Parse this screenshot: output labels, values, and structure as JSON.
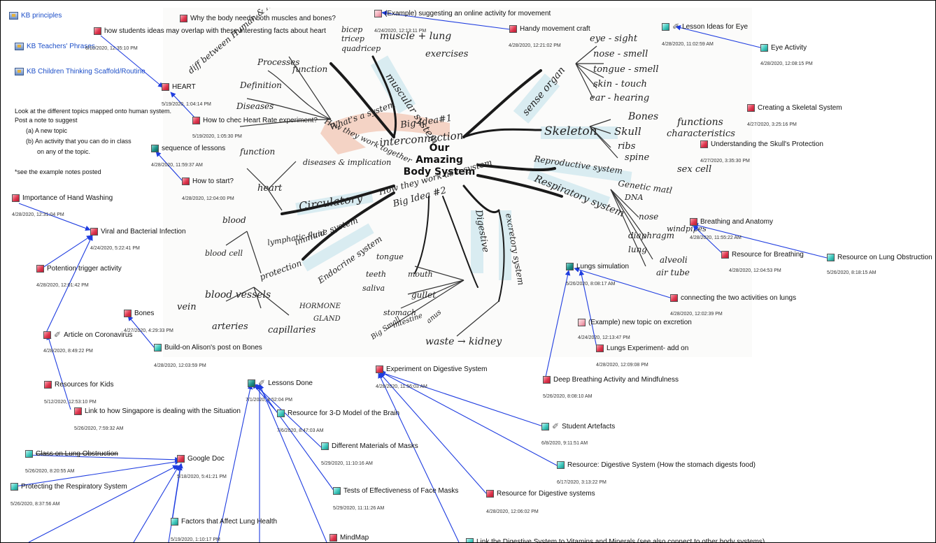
{
  "kb_links": [
    "KB principles",
    "KB Teachers' Phrases",
    "KB Children Thinking Scaffold/Routine"
  ],
  "kb_timestamp": "6/10/2020, 12:35:10 PM",
  "instructions": {
    "line1": "Look at the different topics mapped onto human system.",
    "line2": "Post a note to suggest",
    "line3": "(a)  A new topic",
    "line4": "(b)  An activity that you can do in class",
    "line5": "on any of the topic.",
    "line6": "*see the example notes posted"
  },
  "mindmap": {
    "center_lines": [
      "Our",
      "Amazing",
      "Body System"
    ],
    "labels": {
      "muscular": "muscular system",
      "skeleton": "Skeleton",
      "sense_organ": "sense organ",
      "circulatory": "Circulatory",
      "immune": "immune system",
      "endocrine": "Endocrine system",
      "digestive": "Digestive",
      "excretory": "excretory system",
      "reproductive": "Reproductive system",
      "respiratory": "Respiratory system",
      "big_idea1": "Big Idea#1",
      "interconnection": "interconnection",
      "big_idea2": "Big Idea #2",
      "how_work": "How they work as a system",
      "whats_system": "What's a system",
      "how_together": "How they work together",
      "diff_between": "diff between Human & Animals",
      "processes": "Processes",
      "function": "function",
      "definition": "Definition",
      "diseases": "Diseases",
      "bicep": "bicep",
      "tricep": "tricep",
      "quadricep": "quadricep",
      "muscle_lung": "muscle + lung",
      "exercises": "exercises",
      "eye": "eye - sight",
      "nose": "nose - smell",
      "tongue": "tongue - smell",
      "skin": "skin - touch",
      "ear": "ear - hearing",
      "bones": "Bones",
      "skull": "Skull",
      "ribs": "ribs",
      "spine": "spine",
      "functions": "functions",
      "characteristics": "characteristics",
      "sex_cell": "sex cell",
      "genetic": "Genetic matl",
      "dna": "DNA",
      "nose2": "nose",
      "windpipe": "windpipes",
      "diaphragm": "diaphragm",
      "lung": "lung",
      "alveoli": "alveoli",
      "air_tube": "air tube",
      "heart": "heart",
      "function2": "function",
      "diseases_impl": "diseases & implication",
      "blood": "blood",
      "blood_cell": "blood cell",
      "blood_vessels": "blood vessels",
      "vein": "vein",
      "arteries": "arteries",
      "capillaries": "capillaries",
      "lymphatic": "lymphatic fluid",
      "protection": "protection",
      "hormone": "HORMONE",
      "gland": "GLAND",
      "tongue2": "tongue",
      "teeth": "teeth",
      "saliva": "saliva",
      "mouth": "mouth",
      "gullet": "gullet",
      "stomach": "stomach",
      "intestine": "intestine",
      "anus": "anus",
      "big_small": "Big Small",
      "waste_kidney": "waste → kidney"
    }
  },
  "nodes": [
    {
      "id": "why-body",
      "label": "Why the body needs both muscles and bones?",
      "ts": "",
      "icon": "red"
    },
    {
      "id": "how-ideas",
      "label": "how students ideas may overlap with these interesting facts about heart",
      "ts": "",
      "icon": "red"
    },
    {
      "id": "example-online",
      "label": "(Example) suggesting an online activity for movement",
      "ts": "4/24/2020, 12:13:11 PM",
      "icon": "doc"
    },
    {
      "id": "handy-movement",
      "label": "Handy movement craft",
      "ts": "4/28/2020, 12:21:02 PM",
      "icon": "red"
    },
    {
      "id": "lesson-eye",
      "label": "Lesson Ideas for Eye",
      "ts": "4/28/2020, 11:02:59 AM",
      "icon": "teal",
      "clip": true
    },
    {
      "id": "eye-activity",
      "label": "Eye Activity",
      "ts": "4/28/2020, 12:08:15 PM",
      "icon": "teal"
    },
    {
      "id": "heart",
      "label": "HEART",
      "ts": "5/19/2020, 1:04:14 PM",
      "icon": "red"
    },
    {
      "id": "heart-rate",
      "label": "How to chec Heart Rate experiment?",
      "ts": "5/19/2020, 1:05:30 PM",
      "icon": "red"
    },
    {
      "id": "sequence",
      "label": "sequence of lessons",
      "ts": "4/28/2020, 11:59:37 AM",
      "icon": "dteal"
    },
    {
      "id": "how-start",
      "label": "How to start?",
      "ts": "4/28/2020, 12:04:00 PM",
      "icon": "red"
    },
    {
      "id": "skeletal-system",
      "label": "Creating a Skeletal System",
      "ts": "4/27/2020, 3:25:16 PM",
      "icon": "red"
    },
    {
      "id": "skull-protection",
      "label": "Understanding the Skull's Protection",
      "ts": "4/27/2020, 3:35:30 PM",
      "icon": "red"
    },
    {
      "id": "hand-washing",
      "label": "Importance of Hand Washing",
      "ts": "4/28/2020, 12:31:04 PM",
      "icon": "red"
    },
    {
      "id": "viral",
      "label": "Viral and Bacterial Infection",
      "ts": "4/24/2020, 5:22:41 PM",
      "icon": "red"
    },
    {
      "id": "potention",
      "label": "Potention trigger activity",
      "ts": "4/28/2020, 12:01:42 PM",
      "icon": "red"
    },
    {
      "id": "breathing-anatomy",
      "label": "Breathing and Anatomy",
      "ts": "4/28/2020, 11:55:22 AM",
      "icon": "red"
    },
    {
      "id": "resource-breathing",
      "label": "Resource for Breathing",
      "ts": "4/28/2020, 12:04:53 PM",
      "icon": "red"
    },
    {
      "id": "lung-obstruction",
      "label": "Resource on Lung Obstruction",
      "ts": "5/26/2020, 8:18:15 AM",
      "icon": "teal"
    },
    {
      "id": "lungs-sim",
      "label": "Lungs simulation",
      "ts": "5/26/2020, 8:08:17 AM",
      "icon": "dteal"
    },
    {
      "id": "connecting-lungs",
      "label": "connecting the two activities on lungs",
      "ts": "4/28/2020, 12:02:39 PM",
      "icon": "red"
    },
    {
      "id": "example-excretion",
      "label": "(Example) new topic on excretion",
      "ts": "4/24/2020, 12:13:47 PM",
      "icon": "doc"
    },
    {
      "id": "lungs-experiment",
      "label": "Lungs Experiment- add on",
      "ts": "4/28/2020, 12:09:08 PM",
      "icon": "red"
    },
    {
      "id": "bones",
      "label": "Bones",
      "ts": "4/27/2020, 4:29:33 PM",
      "icon": "red"
    },
    {
      "id": "coronavirus",
      "label": "Article on Coronavirus",
      "ts": "4/28/2020, 8:49:22 PM",
      "icon": "red",
      "clip": true
    },
    {
      "id": "build-alison",
      "label": "Build-on Alison's post on Bones",
      "ts": "4/28/2020, 12:03:59 PM",
      "icon": "teal"
    },
    {
      "id": "deep-breathing",
      "label": "Deep Breathing Activity and Mindfulness",
      "ts": "5/26/2020, 8:08:10 AM",
      "icon": "red"
    },
    {
      "id": "digestive-exp",
      "label": "Experiment on Digestive System",
      "ts": "4/28/2020, 11:56:03 AM",
      "icon": "red"
    },
    {
      "id": "resources-kids",
      "label": "Resources for Kids",
      "ts": "5/12/2020, 12:53:10 PM",
      "icon": "red"
    },
    {
      "id": "lessons-done",
      "label": "Lessons Done",
      "ts": "7/1/2020, 4:52:04 PM",
      "icon": "dteal",
      "clip": true
    },
    {
      "id": "singapore",
      "label": "Link to how Singapore is dealing with the Situation",
      "ts": "5/26/2020, 7:59:32 AM",
      "icon": "red"
    },
    {
      "id": "brain-model",
      "label": "Resource for 3-D Model of the Brain",
      "ts": "7/6/2020, 8:47:03 AM",
      "icon": "teal"
    },
    {
      "id": "student-artefacts",
      "label": "Student Artefacts",
      "ts": "6/8/2020, 9:11:51 AM",
      "icon": "teal",
      "clip": true
    },
    {
      "id": "masks",
      "label": "Different Materials of Masks",
      "ts": "5/29/2020, 11:10:16 AM",
      "icon": "teal"
    },
    {
      "id": "class-lung",
      "label": "Class on Lung Obstruction",
      "ts": "5/26/2020, 8:20:55 AM",
      "icon": "teal",
      "strike": true
    },
    {
      "id": "google-doc",
      "label": "Google Doc",
      "ts": "5/18/2020, 5:41:21 PM",
      "icon": "red"
    },
    {
      "id": "stomach-digests",
      "label": "Resource: Digestive System (How the stomach digests food)",
      "ts": "6/17/2020, 3:13:22 PM",
      "icon": "teal"
    },
    {
      "id": "protecting-resp",
      "label": "Protecting the Respiratory System",
      "ts": "5/26/2020, 8:37:56 AM",
      "icon": "teal"
    },
    {
      "id": "face-masks",
      "label": "Tests of Effectiveness of Face Masks",
      "ts": "5/29/2020, 11:11:26 AM",
      "icon": "teal"
    },
    {
      "id": "digestive-resources",
      "label": "Resource for Digestive systems",
      "ts": "4/28/2020, 12:06:02 PM",
      "icon": "red"
    },
    {
      "id": "lung-health",
      "label": "Factors that Affect Lung Health",
      "ts": "5/19/2020, 1:10:17 PM",
      "icon": "teal"
    },
    {
      "id": "mindmap",
      "label": "MindMap",
      "ts": "",
      "icon": "red"
    },
    {
      "id": "vitamins",
      "label": "Link the Digestive System to Vitamins and Minerals (see also connect to other body systems)",
      "ts": "",
      "icon": "teal"
    }
  ]
}
